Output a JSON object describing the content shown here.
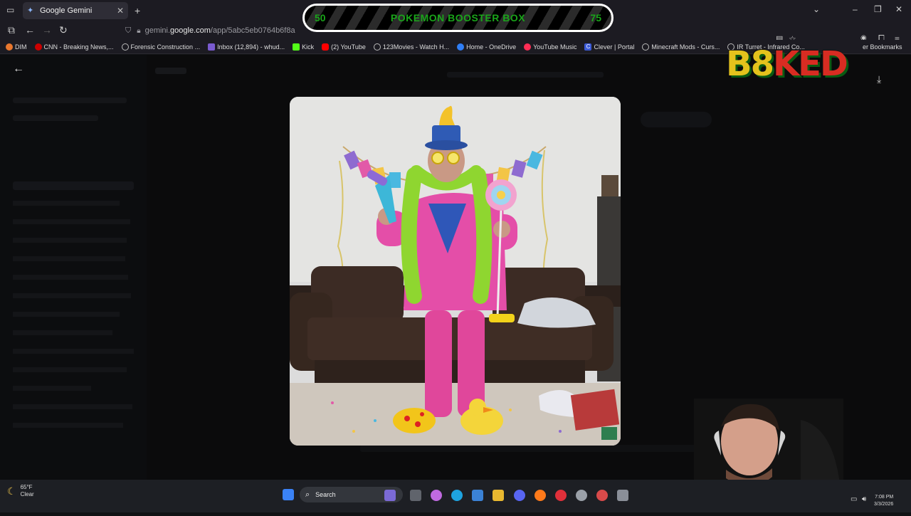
{
  "browser": {
    "tab_title": "Google Gemini",
    "url_prefix": "gemini.",
    "url_domain": "google.com",
    "url_path": "/app/5abc5eb0764b6f8a",
    "bookmarks": [
      {
        "label": "DIM",
        "icon": "orange-icon",
        "color": "#e8772e"
      },
      {
        "label": "CNN - Breaking News,...",
        "icon": "cnn-icon",
        "color": "#cc0000"
      },
      {
        "label": "Forensic Construction ...",
        "icon": "globe-icon",
        "color": "#777777"
      },
      {
        "label": "Inbox (12,894) - whud...",
        "icon": "mail-icon",
        "color": "#7a5bd0"
      },
      {
        "label": "Kick",
        "icon": "kick-icon",
        "color": "#53fc18"
      },
      {
        "label": "(2) YouTube",
        "icon": "youtube-icon",
        "color": "#ff0000"
      },
      {
        "label": "123Movies - Watch H...",
        "icon": "globe-icon",
        "color": "#777777"
      },
      {
        "label": "Home - OneDrive",
        "icon": "cloud-icon",
        "color": "#2f7ef6"
      },
      {
        "label": "YouTube Music",
        "icon": "music-icon",
        "color": "#ff2d55"
      },
      {
        "label": "Clever | Portal",
        "icon": "clever-icon",
        "color": "#3c5bd8"
      },
      {
        "label": "Minecraft Mods - Curs...",
        "icon": "globe-icon",
        "color": "#777777"
      },
      {
        "label": "IR Turret - Infrared Co...",
        "icon": "globe-icon",
        "color": "#777777"
      }
    ],
    "other_bookmarks": "er Bookmarks"
  },
  "overlay": {
    "left_num": "50",
    "title": "POKEMON BOOSTER BOX",
    "right_num": "75"
  },
  "logo": {
    "part1": "B8",
    "part2": "KED"
  },
  "taskbar": {
    "temperature": "65°F",
    "condition": "Clear",
    "search_placeholder": "Search",
    "time": "7:08 PM",
    "date": "3/3/2026"
  }
}
